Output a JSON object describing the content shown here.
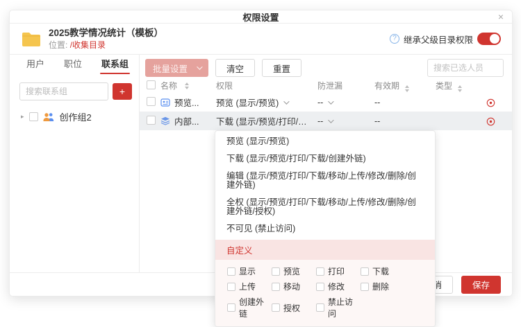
{
  "modal": {
    "title": "权限设置",
    "file": {
      "name": "2025教学情况统计（模板）",
      "location_label": "位置:",
      "location_link": "/收集目录"
    },
    "inherit": {
      "label": "继承父级目录权限",
      "enabled": true
    }
  },
  "icons": {
    "help": "?",
    "close": "×",
    "add": "+",
    "expand": "▸"
  },
  "sidebar": {
    "tabs": [
      {
        "label": "用户"
      },
      {
        "label": "职位"
      },
      {
        "label": "联系组"
      }
    ],
    "active_tab": "联系组",
    "search_placeholder": "搜索联系组",
    "tree": [
      {
        "label": "创作组2"
      }
    ]
  },
  "toolbar": {
    "batch_label": "批量设置",
    "clear_label": "清空",
    "reset_label": "重置",
    "search_placeholder": "搜索已选人员"
  },
  "table": {
    "columns": {
      "name": "名称",
      "permission": "权限",
      "leakproof": "防泄漏",
      "expiry": "有效期",
      "type": "类型"
    },
    "rows": [
      {
        "name": "预览...",
        "permission": "预览 (显示/预览)",
        "leakproof": "--",
        "expiry": "--",
        "icon": "badge-icon"
      },
      {
        "name": "内部...",
        "permission": "下载 (显示/预览/打印/下载/创...",
        "leakproof": "--",
        "expiry": "--",
        "icon": "layers-icon",
        "highlighted": true
      }
    ]
  },
  "dropdown": {
    "options": [
      "预览 (显示/预览)",
      "下载 (显示/预览/打印/下载/创建外链)",
      "编辑 (显示/预览/打印/下载/移动/上传/修改/删除/创建外链)",
      "全权 (显示/预览/打印/下载/移动/上传/修改/删除/创建外链/授权)",
      "不可见 (禁止访问)"
    ],
    "custom_label": "自定义",
    "custom_options": [
      "显示",
      "预览",
      "打印",
      "下载",
      "上传",
      "移动",
      "修改",
      "删除",
      "创建外链",
      "授权",
      "禁止访问"
    ]
  },
  "footer": {
    "cancel_label": "取消",
    "save_label": "保存"
  },
  "colors": {
    "accent": "#d0352f",
    "accent_soft": "#e5a29d",
    "custom_band_bg": "#f9e4e3",
    "row_highlight": "#edeff1",
    "link": "#d0352f"
  }
}
